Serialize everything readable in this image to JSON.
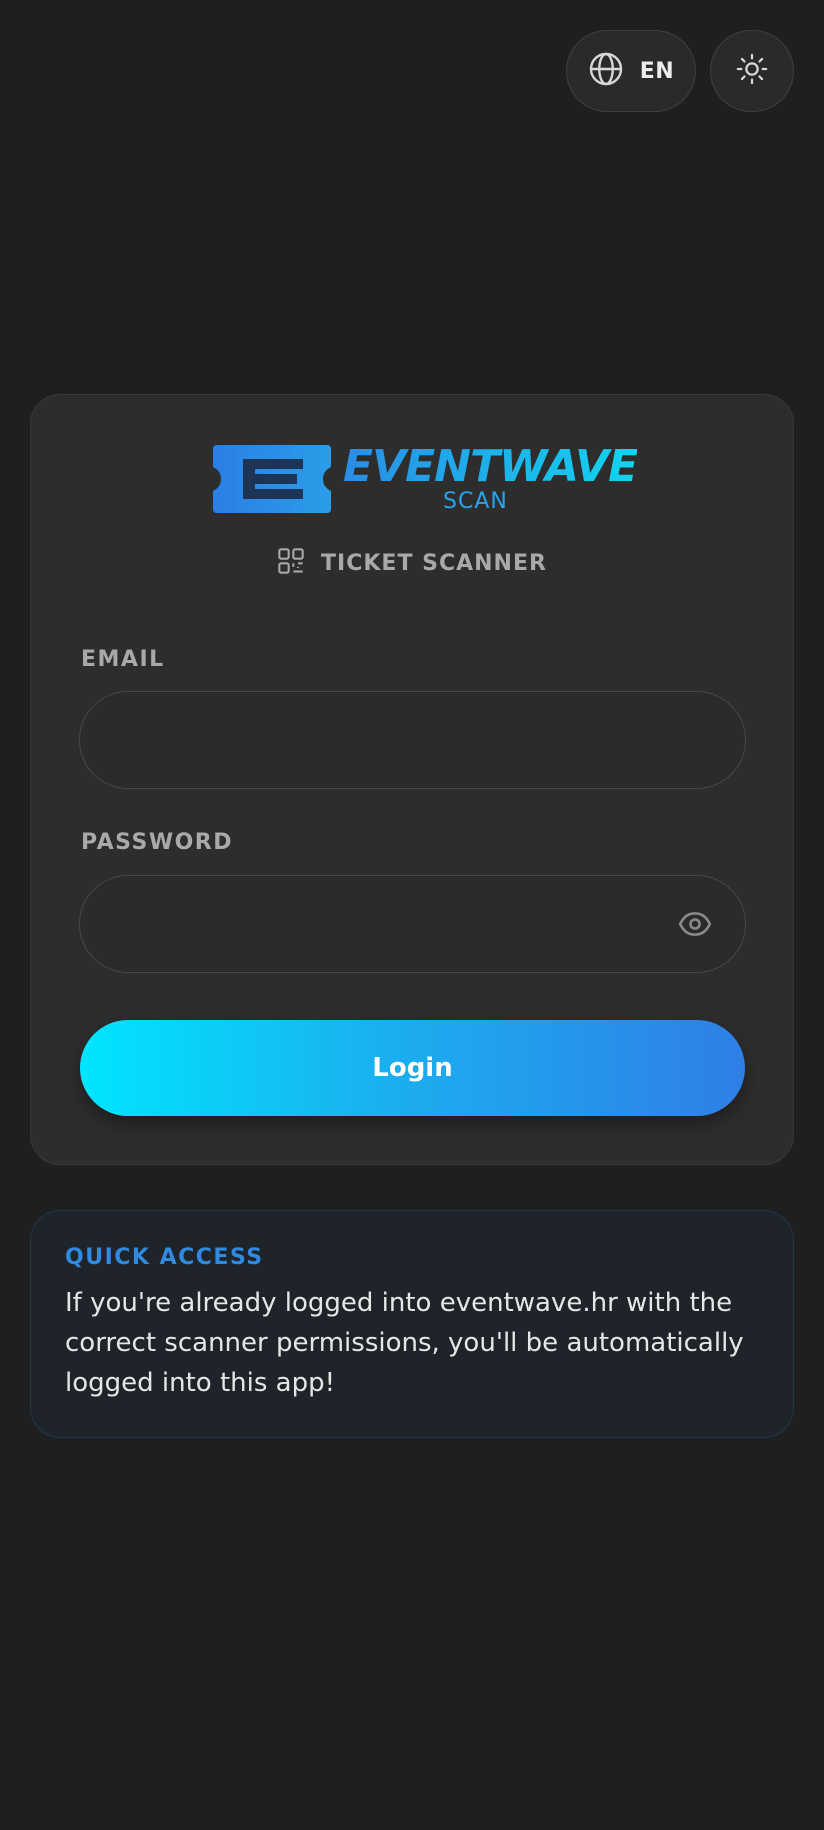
{
  "header": {
    "language_code": "EN",
    "language_icon": "globe-icon",
    "theme_icon": "sun-icon"
  },
  "brand": {
    "name": "EVENTWAVE",
    "sub": "SCAN",
    "colors": {
      "primary": "#2a8de6",
      "accent": "#12d4ef"
    }
  },
  "login_card": {
    "subtitle": "TICKET SCANNER",
    "subtitle_icon": "qr-code-icon",
    "email_label": "EMAIL",
    "email_value": "",
    "password_label": "PASSWORD",
    "password_value": "",
    "password_toggle_icon": "eye-icon",
    "login_label": "Login"
  },
  "quick_access": {
    "title": "QUICK ACCESS",
    "text": "If you're already logged into eventwave.hr with the correct scanner permissions, you'll be automatically logged into this app!"
  }
}
